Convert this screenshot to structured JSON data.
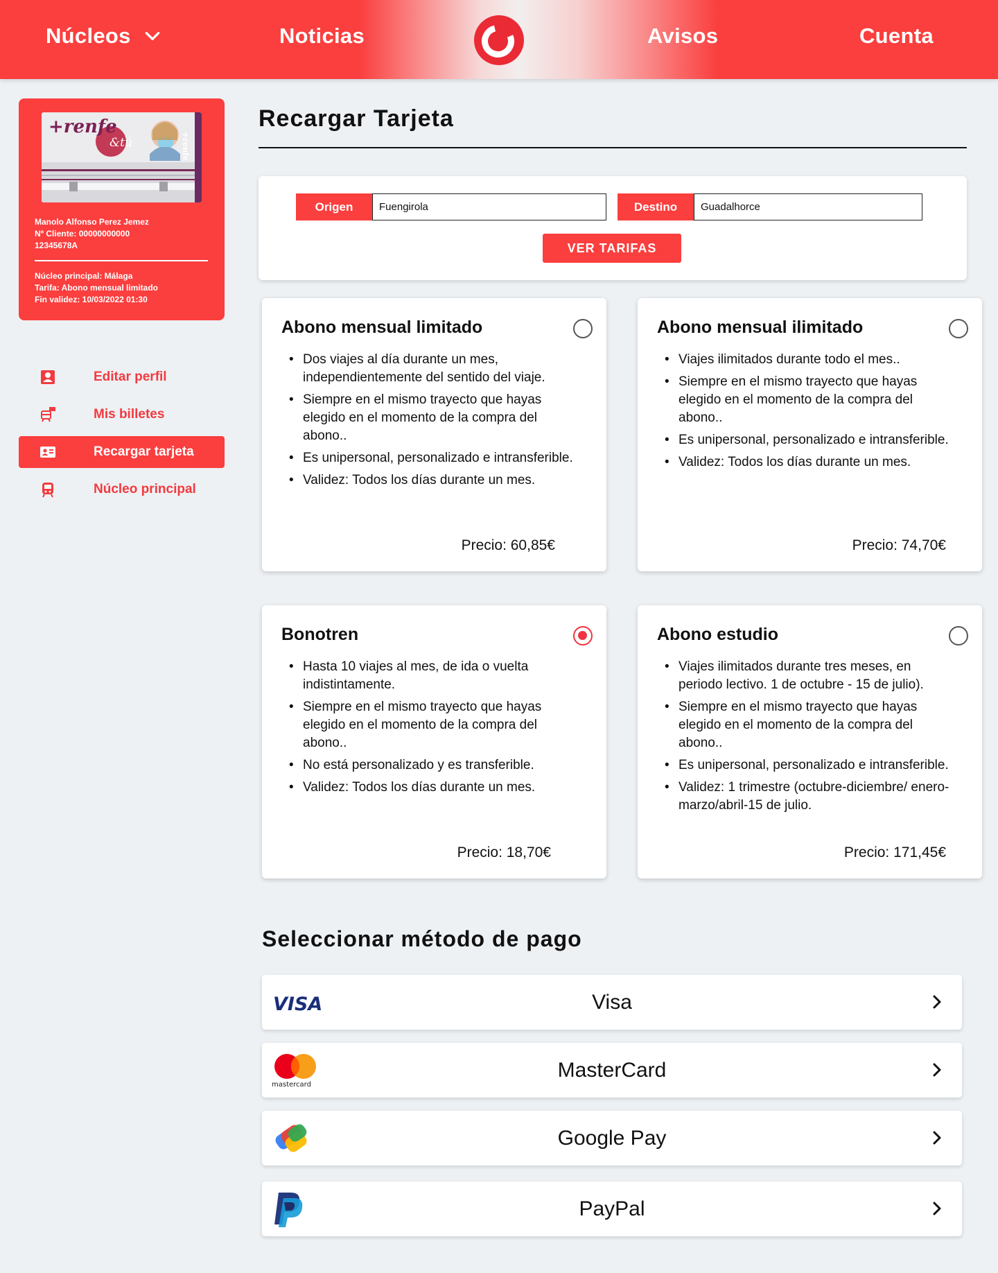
{
  "nav": {
    "nucleos": "Núcleos",
    "noticias": "Noticias",
    "avisos": "Avisos",
    "cuenta": "Cuenta"
  },
  "user_card": {
    "name": "Manolo Alfonso Perez Jemez",
    "client": "Nº Cliente: 00000000000",
    "id": "12345678A",
    "nucleo": "Núcleo principal: Málaga",
    "tarifa": "Tarifa: Abono mensual limitado",
    "validez": "Fin validez: 10/03/2022 01:30",
    "card_brand": "+renfe",
    "card_sub": "&tú",
    "card_side": "+renfe"
  },
  "menu": [
    {
      "label": "Editar perfil",
      "icon": "profile-icon",
      "active": false
    },
    {
      "label": "Mis billetes",
      "icon": "train-ticket-icon",
      "active": false
    },
    {
      "label": "Recargar tarjeta",
      "icon": "id-card-icon",
      "active": true
    },
    {
      "label": "Núcleo principal",
      "icon": "train-icon",
      "active": false
    }
  ],
  "page_title": "Recargar Tarjeta",
  "route": {
    "origen_label": "Origen",
    "origen_value": "Fuengirola",
    "destino_label": "Destino",
    "destino_value": "Guadalhorce",
    "button": "VER TARIFAS"
  },
  "plans": [
    {
      "title": "Abono mensual limitado",
      "selected": false,
      "items": [
        "Dos viajes al día durante un mes, independientemente del sentido del viaje.",
        "Siempre en el mismo trayecto que hayas elegido en el momento de la compra del abono..",
        "Es unipersonal, personalizado e intransferible.",
        "Validez: Todos los días durante un mes."
      ],
      "price": "Precio: 60,85€"
    },
    {
      "title": "Abono mensual ilimitado",
      "selected": false,
      "items": [
        "Viajes ilimitados durante todo el mes..",
        "Siempre en el mismo trayecto que hayas elegido en el momento de la compra del abono..",
        "Es unipersonal, personalizado e intransferible.",
        "Validez: Todos los días durante un mes."
      ],
      "price": "Precio: 74,70€"
    },
    {
      "title": "Bonotren",
      "selected": true,
      "items": [
        "Hasta 10 viajes al mes, de ida o vuelta indistintamente.",
        "Siempre en el mismo trayecto que hayas elegido en el momento de la compra del abono..",
        "No está personalizado y es transferible.",
        "Validez: Todos los días durante un mes."
      ],
      "price": "Precio: 18,70€"
    },
    {
      "title": "Abono estudio",
      "selected": false,
      "items": [
        "Viajes ilimitados durante tres meses, en periodo lectivo. 1 de octubre - 15 de julio).",
        "Siempre en el mismo trayecto que hayas elegido en el momento de la compra del abono..",
        "Es unipersonal, personalizado e intransferible.",
        "Validez:  1 trimestre (octubre-diciembre/ enero-marzo/abril-15 de julio."
      ],
      "price": "Precio: 171,45€"
    }
  ],
  "payment": {
    "title": "Seleccionar método de pago",
    "methods": [
      {
        "label": "Visa",
        "logo": "visa-logo"
      },
      {
        "label": "MasterCard",
        "logo": "mastercard-logo",
        "logo_text": "mastercard"
      },
      {
        "label": "Google Pay",
        "logo": "google-pay-logo"
      },
      {
        "label": "PayPal",
        "logo": "paypal-logo"
      }
    ]
  },
  "colors": {
    "brand_red": "#fb3e3e",
    "radio_selected": "#ef3540",
    "background": "#eef1f4"
  }
}
